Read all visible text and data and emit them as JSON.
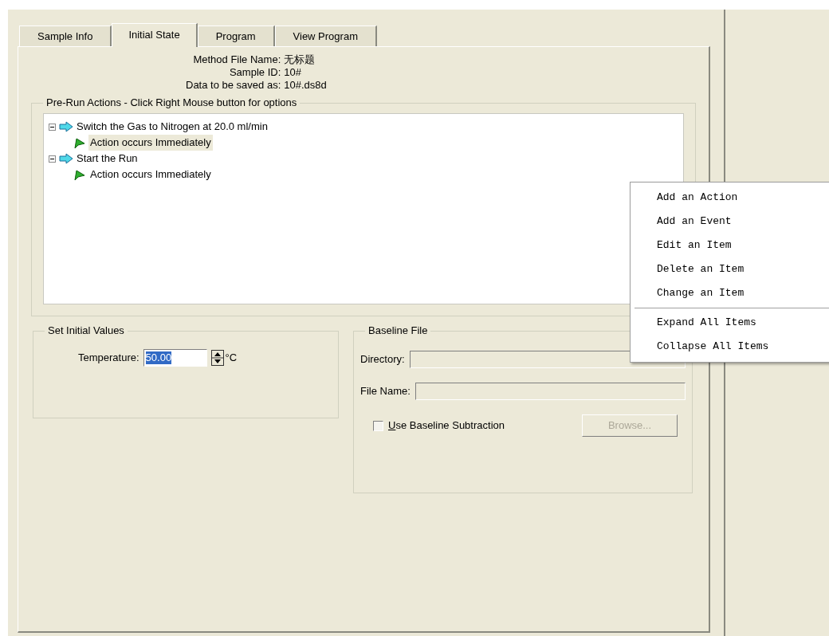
{
  "tabs": [
    {
      "label": "Sample Info",
      "selected": false
    },
    {
      "label": "Initial State",
      "selected": true
    },
    {
      "label": "Program",
      "selected": false
    },
    {
      "label": "View Program",
      "selected": false
    }
  ],
  "info": [
    {
      "label": "Method File Name:",
      "value": "无标题"
    },
    {
      "label": "Sample ID:",
      "value": "10#"
    },
    {
      "label": "Data to be saved as:",
      "value": "10#.ds8d"
    }
  ],
  "pre_run": {
    "title": "Pre-Run Actions - Click Right Mouse button for options",
    "items": [
      {
        "label": "Switch the Gas to Nitrogen at 20.0 ml/min",
        "expanded": true,
        "children": [
          {
            "label": "Action occurs Immediately",
            "selected": true
          }
        ]
      },
      {
        "label": "Start the Run",
        "expanded": true,
        "children": [
          {
            "label": "Action occurs Immediately",
            "selected": false
          }
        ]
      }
    ]
  },
  "initial_values": {
    "title": "Set Initial Values",
    "label": "Temperature:",
    "value": "50.00",
    "value_selected": true,
    "unit": "°C"
  },
  "baseline": {
    "title": "Baseline File",
    "fields": [
      {
        "label": "Directory:"
      },
      {
        "label": "File Name:"
      }
    ],
    "checkbox": {
      "label": "Use Baseline Subtraction",
      "checked": false
    },
    "browse": {
      "label": "Browse...",
      "disabled": true
    }
  },
  "context_menu": [
    {
      "kind": "item",
      "label": "Add an Action"
    },
    {
      "kind": "item",
      "label": "Add an Event"
    },
    {
      "kind": "item",
      "label": "Edit an Item"
    },
    {
      "kind": "item",
      "label": "Delete an Item"
    },
    {
      "kind": "item",
      "label": "Change an Item"
    },
    {
      "kind": "separator"
    },
    {
      "kind": "item",
      "label": "Expand All Items"
    },
    {
      "kind": "item",
      "label": "Collapse All Items"
    }
  ]
}
